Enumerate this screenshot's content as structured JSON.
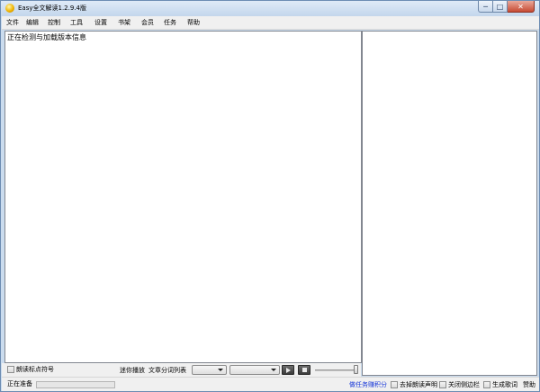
{
  "window": {
    "title": "Easy全文解读1.2.9.4版",
    "buttons": {
      "minimize": "─",
      "maximize": "□",
      "close": "✕"
    }
  },
  "menu": [
    "文件",
    "编辑",
    "控制",
    "工具",
    "设置",
    "书架",
    "会员",
    "任务",
    "帮助"
  ],
  "editor": {
    "text": "正在检测与加载版本信息"
  },
  "controls": {
    "read_punct_label": "朗读标点符号",
    "read_punct_checked": false,
    "mini_play_label": "迷你播放",
    "word_list_label": "文章分词列表",
    "combo1_value": "",
    "combo2_value": "",
    "volume_level": 1.0
  },
  "statusbar": {
    "status_text": "正在准备",
    "progress_fraction": 0,
    "earn_points_link": "做任务赚积分",
    "options": [
      {
        "label": "去掉朗读声明",
        "checked": false
      },
      {
        "label": "关闭侧边栏",
        "checked": false
      },
      {
        "label": "生成歌词",
        "checked": false
      }
    ],
    "help_label": "赞助"
  },
  "icons": {
    "app": "app-icon",
    "play": "play-icon",
    "stop": "stop-icon",
    "dropdown": "chevron-down-icon"
  }
}
